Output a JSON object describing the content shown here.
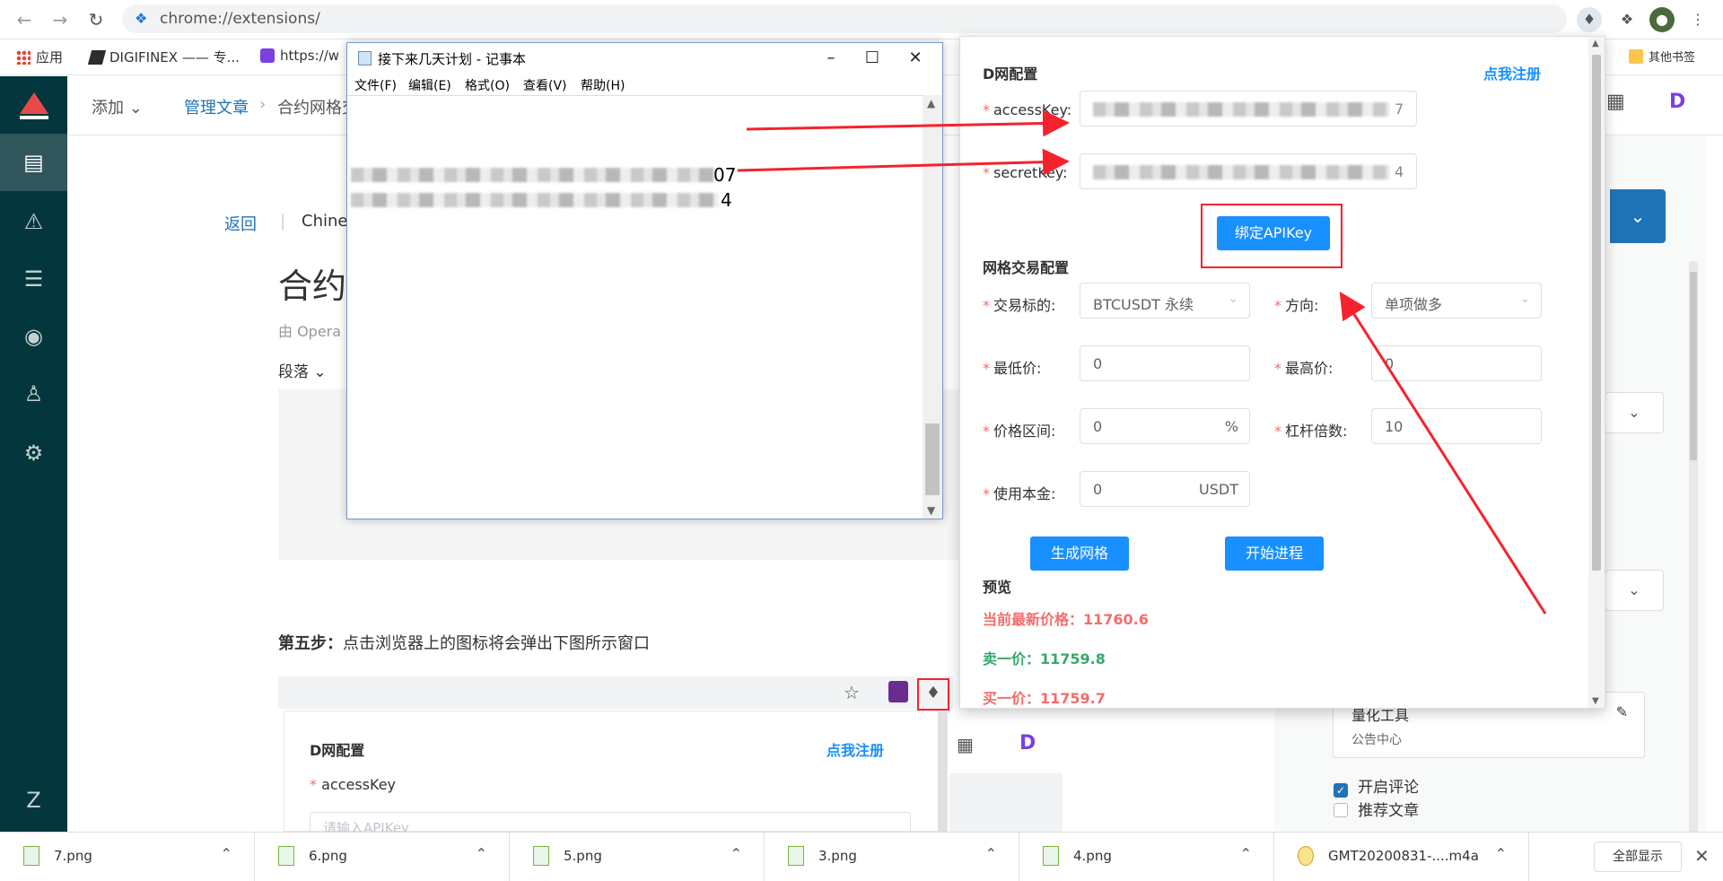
{
  "browser": {
    "url": "chrome://extensions/",
    "bookmarks": [
      "应用",
      "DIGIFINEX —— 专...",
      "https://w",
      "其他书签"
    ]
  },
  "cms": {
    "topbar": {
      "add": "添加",
      "manage": "管理文章",
      "current": "合约网格交"
    },
    "back": "返回",
    "lang": "Chines",
    "title": "合约",
    "byline": "由 Opera",
    "paragraph": "段落",
    "step_label": "第五步：",
    "step_text": "点击浏览器上的图标将会弹出下图所示窗口",
    "inner": {
      "section": "D网配置",
      "register": "点我注册",
      "field": "accessKey",
      "placeholder": "请输入APIKey"
    },
    "right": {
      "item_title": "量化工具",
      "item_sub": "公告中心",
      "enable_comment": "开启评论",
      "recommend": "推荐文章"
    }
  },
  "notepad": {
    "title": "接下来几天计划 - 记事本",
    "menu": [
      "文件(F)",
      "编辑(E)",
      "格式(O)",
      "查看(V)",
      "帮助(H)"
    ],
    "line1_tail": "07",
    "line2_tail": "4"
  },
  "popup": {
    "section1": "D网配置",
    "register": "点我注册",
    "access_label": "accessKey",
    "access_tail": "7",
    "secret_label": "secretKey",
    "secret_tail": "4",
    "bind_button": "绑定APIKey",
    "section2": "网格交易配置",
    "symbol_label": "交易标的",
    "symbol_value": "BTCUSDT 永续",
    "direction_label": "方向",
    "direction_value": "单项做多",
    "min_label": "最低价",
    "min_value": "0",
    "max_label": "最高价",
    "max_value": "0",
    "range_label": "价格区间",
    "range_value": "0",
    "range_suffix": "%",
    "leverage_label": "杠杆倍数",
    "leverage_value": "10",
    "capital_label": "使用本金",
    "capital_value": "0",
    "capital_suffix": "USDT",
    "gen_button": "生成网格",
    "start_button": "开始进程",
    "preview": "预览",
    "latest_label": "当前最新价格：",
    "latest_value": "11760.6",
    "sell_label": "卖一价：",
    "sell_value": "11759.8",
    "buy_label": "买一价：",
    "buy_value": "11759.7"
  },
  "downloads": {
    "files": [
      "7.png",
      "6.png",
      "5.png",
      "3.png",
      "4.png",
      "GMT20200831-....m4a"
    ],
    "show_all": "全部显示"
  },
  "colors": {
    "sidebar": "#03363d",
    "primary": "#1890ff",
    "danger": "#f5222d"
  }
}
